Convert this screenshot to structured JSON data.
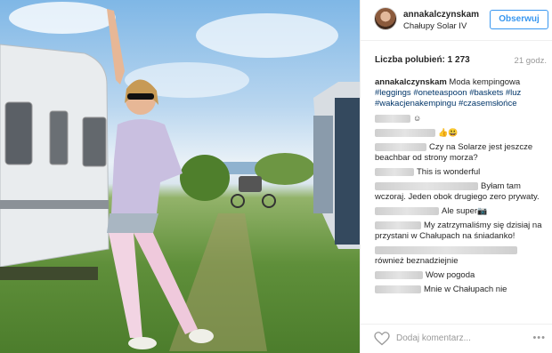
{
  "post": {
    "username": "annakalczynskam",
    "location": "Chałupy Solar IV",
    "follow_label": "Obserwuj",
    "likes_label": "Liczba polubień: 1 273",
    "time_ago": "21 godz.",
    "caption": {
      "author": "annakalczynskam",
      "text": " Moda kempingowa",
      "hashtags": [
        "#leggings",
        "#oneteaspoon",
        "#baskets",
        "#luz",
        "#wakacjenakempingu",
        "#czasemsłońce"
      ]
    },
    "comments": [
      {
        "text": "",
        "emoji": "☺"
      },
      {
        "text": "",
        "emoji": "👍😃"
      },
      {
        "text": "Czy na Solarze jest jeszcze beachbar od strony morza?",
        "emoji": ""
      },
      {
        "text": "This is wonderful",
        "emoji": ""
      },
      {
        "text": "Byłam tam wczoraj. Jeden obok drugiego zero prywaty.",
        "emoji": ""
      },
      {
        "text": "Ale super",
        "emoji": "📷"
      },
      {
        "text": "My zatrzymaliśmy się dzisiaj na przystani w Chałupach na śniadanko!",
        "emoji": ""
      },
      {
        "text": "również beznadziejnie",
        "emoji": ""
      },
      {
        "text": "Wow pogoda",
        "emoji": ""
      },
      {
        "text": "Mnie w Chałupach nie",
        "emoji": ""
      }
    ],
    "add_comment_placeholder": "Dodaj komentarz...",
    "more_label": "•••"
  },
  "colors": {
    "accent": "#3897f0",
    "hashtag": "#003569",
    "muted": "#999999"
  },
  "icons": {
    "like": "heart-icon",
    "options": "more-options-icon"
  }
}
